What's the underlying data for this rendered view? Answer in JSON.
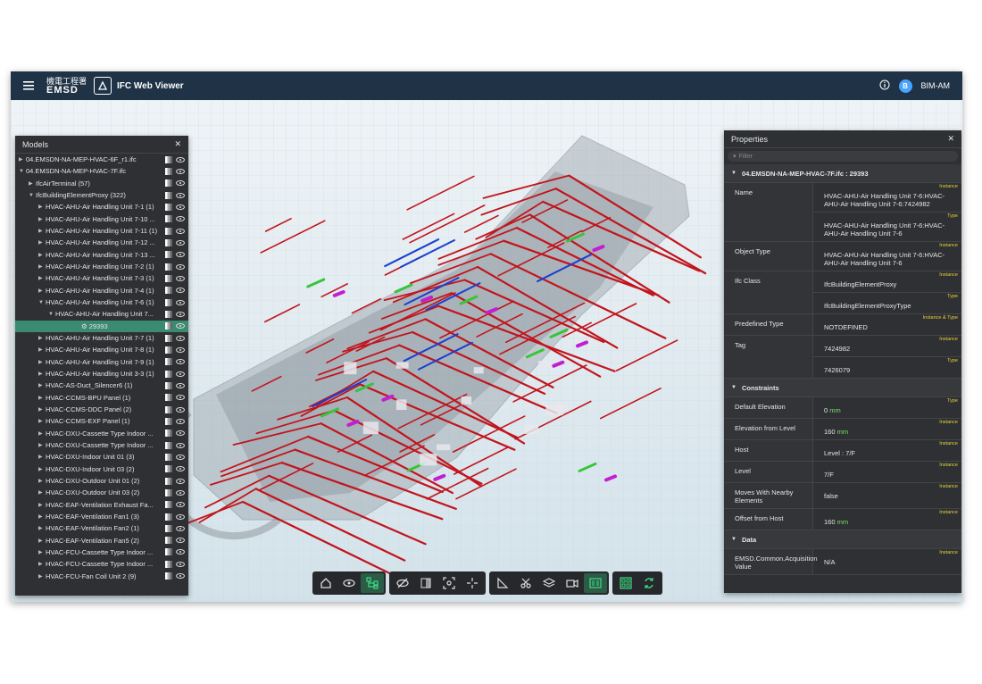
{
  "app": {
    "logo_cn": "機電工程署",
    "logo_en": "EMSD",
    "title": "IFC Web Viewer",
    "user_initial": "B",
    "user_name": "BIM-AM"
  },
  "models": {
    "title": "Models",
    "rows": [
      {
        "label": "04.EMSDN-NA-MEP-HVAC-6F_r1.ifc",
        "level": 0,
        "caret": "▶"
      },
      {
        "label": "04.EMSDN-NA-MEP-HVAC-7F.ifc",
        "level": 0,
        "caret": "▼"
      },
      {
        "label": "IfcAirTerminal (57)",
        "level": 1,
        "caret": "▶"
      },
      {
        "label": "IfcBuildingElementProxy (322)",
        "level": 1,
        "caret": "▼"
      },
      {
        "label": "HVAC-AHU-Air Handling Unit 7-1 (1)",
        "level": 2,
        "caret": "▶"
      },
      {
        "label": "HVAC-AHU-Air Handling Unit 7-10 ...",
        "level": 2,
        "caret": "▶"
      },
      {
        "label": "HVAC-AHU-Air Handling Unit 7-11 (1)",
        "level": 2,
        "caret": "▶"
      },
      {
        "label": "HVAC-AHU-Air Handling Unit 7-12 ...",
        "level": 2,
        "caret": "▶"
      },
      {
        "label": "HVAC-AHU-Air Handling Unit 7-13 ...",
        "level": 2,
        "caret": "▶"
      },
      {
        "label": "HVAC-AHU-Air Handling Unit 7-2 (1)",
        "level": 2,
        "caret": "▶"
      },
      {
        "label": "HVAC-AHU-Air Handling Unit 7-3 (1)",
        "level": 2,
        "caret": "▶"
      },
      {
        "label": "HVAC-AHU-Air Handling Unit 7-4 (1)",
        "level": 2,
        "caret": "▶"
      },
      {
        "label": "HVAC-AHU-Air Handling Unit 7-6 (1)",
        "level": 2,
        "caret": "▼"
      },
      {
        "label": "HVAC-AHU-Air Handling Unit 7...",
        "level": 3,
        "caret": "▼"
      },
      {
        "label": "⚙ 29393",
        "level": 4,
        "caret": "",
        "selected": true
      },
      {
        "label": "HVAC-AHU-Air Handling Unit 7-7 (1)",
        "level": 2,
        "caret": "▶"
      },
      {
        "label": "HVAC-AHU-Air Handling Unit 7-8 (1)",
        "level": 2,
        "caret": "▶"
      },
      {
        "label": "HVAC-AHU-Air Handling Unit 7-9 (1)",
        "level": 2,
        "caret": "▶"
      },
      {
        "label": "HVAC-AHU-Air Handling Unit 3-3 (1)",
        "level": 2,
        "caret": "▶"
      },
      {
        "label": "HVAC-AS-Duct_Silencer6 (1)",
        "level": 2,
        "caret": "▶"
      },
      {
        "label": "HVAC-CCMS-BPU Panel (1)",
        "level": 2,
        "caret": "▶"
      },
      {
        "label": "HVAC-CCMS-DDC Panel (2)",
        "level": 2,
        "caret": "▶"
      },
      {
        "label": "HVAC-CCMS-EXF Panel (1)",
        "level": 2,
        "caret": "▶"
      },
      {
        "label": "HVAC-DXU-Cassette Type Indoor ...",
        "level": 2,
        "caret": "▶"
      },
      {
        "label": "HVAC-DXU-Cassette Type Indoor ...",
        "level": 2,
        "caret": "▶"
      },
      {
        "label": "HVAC-DXU-Indoor Unit 01 (3)",
        "level": 2,
        "caret": "▶"
      },
      {
        "label": "HVAC-DXU-Indoor Unit 03 (2)",
        "level": 2,
        "caret": "▶"
      },
      {
        "label": "HVAC-DXU-Outdoor Unit 01 (2)",
        "level": 2,
        "caret": "▶"
      },
      {
        "label": "HVAC-DXU-Outdoor Unit 03 (2)",
        "level": 2,
        "caret": "▶"
      },
      {
        "label": "HVAC-EAF-Ventilation Exhaust Fa...",
        "level": 2,
        "caret": "▶"
      },
      {
        "label": "HVAC-EAF-Ventilation Fan1 (3)",
        "level": 2,
        "caret": "▶"
      },
      {
        "label": "HVAC-EAF-Ventilation Fan2 (1)",
        "level": 2,
        "caret": "▶"
      },
      {
        "label": "HVAC-EAF-Ventilation Fan5 (2)",
        "level": 2,
        "caret": "▶"
      },
      {
        "label": "HVAC-FCU-Cassette Type Indoor ...",
        "level": 2,
        "caret": "▶"
      },
      {
        "label": "HVAC-FCU-Cassette Type Indoor ...",
        "level": 2,
        "caret": "▶"
      },
      {
        "label": "HVAC-FCU-Fan Coil Unit 2 (9)",
        "level": 2,
        "caret": "▶"
      }
    ]
  },
  "properties": {
    "title": "Properties",
    "filter_placeholder": "Filter",
    "header": "04.EMSDN-NA-MEP-HVAC-7F.ifc : 29393",
    "rows": [
      {
        "name": "Name",
        "values": [
          {
            "tag": "Instance",
            "text": "HVAC-AHU-Air Handling Unit 7-6:HVAC-AHU-Air Handling Unit 7-6:7424982"
          },
          {
            "tag": "Type",
            "text": "HVAC-AHU-Air Handling Unit 7-6:HVAC-AHU-Air Handling Unit 7-6"
          }
        ]
      },
      {
        "name": "Object Type",
        "values": [
          {
            "tag": "Instance",
            "text": "HVAC-AHU-Air Handling Unit 7-6:HVAC-AHU-Air Handling Unit 7-6"
          }
        ]
      },
      {
        "name": "Ifc Class",
        "values": [
          {
            "tag": "Instance",
            "text": "IfcBuildingElementProxy"
          },
          {
            "tag": "Type",
            "text": "IfcBuildingElementProxyType"
          }
        ]
      },
      {
        "name": "Predefined Type",
        "values": [
          {
            "tag": "Instance & Type",
            "text": "NOTDEFINED"
          }
        ]
      },
      {
        "name": "Tag",
        "values": [
          {
            "tag": "Instance",
            "text": "7424982"
          },
          {
            "tag": "Type",
            "text": "7426079"
          }
        ]
      }
    ],
    "constraints_title": "Constraints",
    "constraints": [
      {
        "name": "Default Elevation",
        "tag": "Type",
        "text": "0",
        "unit": "mm"
      },
      {
        "name": "Elevation from Level",
        "tag": "Instance",
        "text": "160",
        "unit": "mm"
      },
      {
        "name": "Host",
        "tag": "Instance",
        "text": "Level : 7/F",
        "unit": ""
      },
      {
        "name": "Level",
        "tag": "Instance",
        "text": "7/F",
        "unit": ""
      },
      {
        "name": "Moves With Nearby Elements",
        "tag": "Instance",
        "text": "false",
        "unit": ""
      },
      {
        "name": "Offset from Host",
        "tag": "Instance",
        "text": "160",
        "unit": "mm"
      }
    ],
    "data_title": "Data",
    "data": [
      {
        "name": "EMSD.Common.Acquisition Value",
        "tag": "Instance",
        "text": "N/A",
        "unit": ""
      }
    ]
  },
  "toolbar": {
    "groups": [
      [
        "home-icon",
        "eye-icon",
        "tree-structure-icon"
      ],
      [
        "eye-off-icon",
        "xray-icon",
        "focus-icon",
        "crosshair-icon"
      ],
      [
        "measure-icon",
        "scissors-icon",
        "layers-icon",
        "camera-icon",
        "properties-icon"
      ],
      [
        "grid-icon",
        "sync-icon"
      ]
    ],
    "active": [
      "tree-structure-icon",
      "properties-icon",
      "grid-icon",
      "sync-icon"
    ]
  },
  "colors": {
    "topbar": "#1f3246",
    "panel": "#2e3033",
    "selected": "#3a8b6f",
    "accent_green": "#7ddf6a",
    "tag_yellow": "#e7d33a",
    "duct_red": "#c2141c",
    "pipe_blue": "#1b3fd1",
    "pipe_green": "#39c43b",
    "equipment_magenta": "#c21fd1"
  }
}
